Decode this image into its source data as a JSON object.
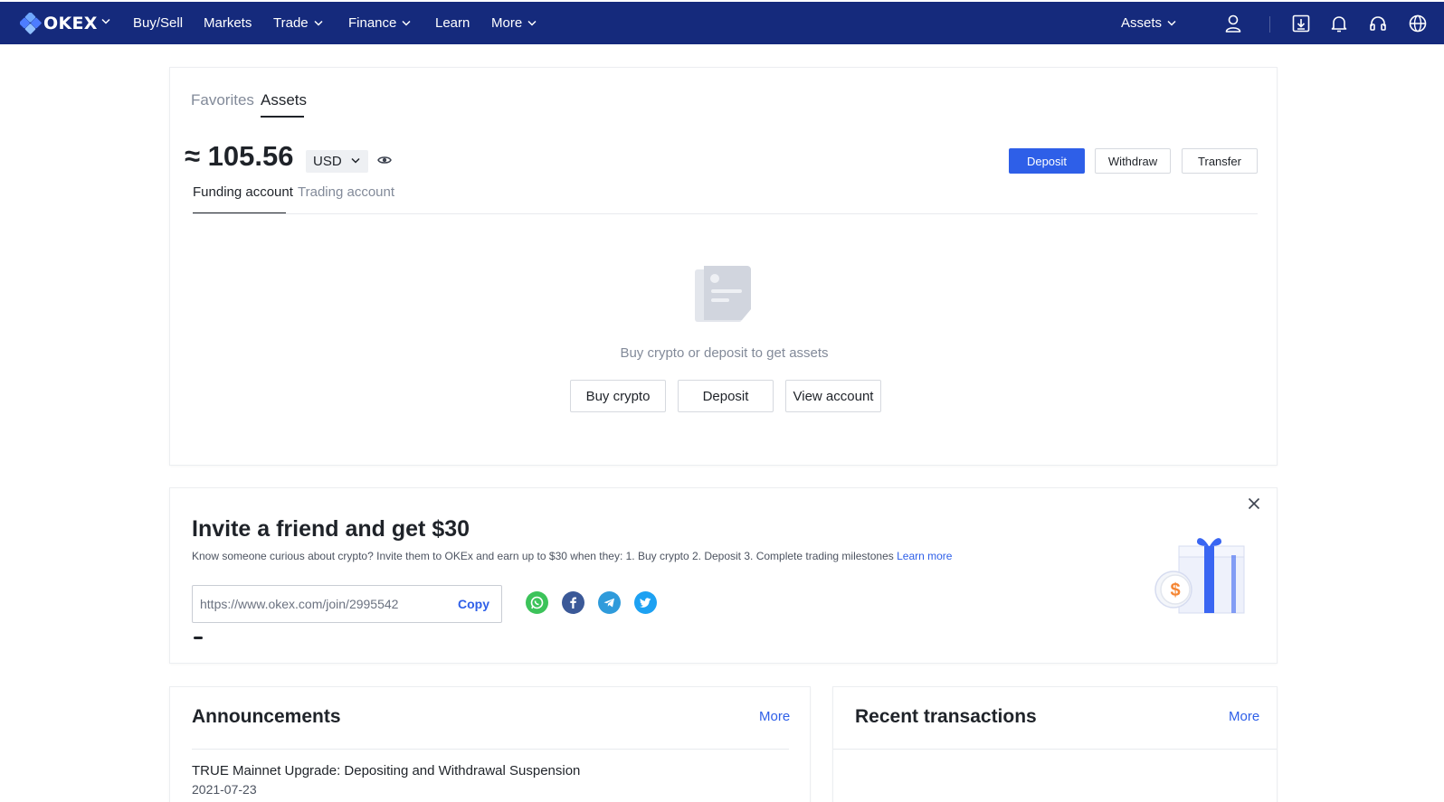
{
  "nav": {
    "brand": "OKEX",
    "items": [
      {
        "label": "Buy/Sell"
      },
      {
        "label": "Markets"
      },
      {
        "label": "Trade"
      },
      {
        "label": "Finance"
      },
      {
        "label": "Learn"
      },
      {
        "label": "More"
      }
    ],
    "assets_label": "Assets",
    "icons": [
      "user-icon",
      "download-icon",
      "bell-icon",
      "headset-icon",
      "globe-icon"
    ]
  },
  "assets_card": {
    "tabs": [
      "Favorites",
      "Assets"
    ],
    "active_tab": "Assets",
    "balance": "≈ 105.56",
    "currency": "USD",
    "actions": {
      "deposit": "Deposit",
      "withdraw": "Withdraw",
      "transfer": "Transfer"
    },
    "account_tabs": [
      "Funding account",
      "Trading account"
    ],
    "active_account_tab": "Funding account",
    "empty_state": {
      "message": "Buy crypto or deposit to get assets",
      "buttons": {
        "buy": "Buy crypto",
        "deposit": "Deposit",
        "view": "View account"
      }
    }
  },
  "invite": {
    "title": "Invite a friend and get $30",
    "description": "Know someone curious about crypto? Invite them to OKEx and earn up to $30 when they: 1. Buy crypto 2. Deposit 3. Complete trading milestones",
    "learn_more": "Learn more",
    "referral_url": "https://www.okex.com/join/2995542",
    "copy_label": "Copy",
    "social": [
      "whatsapp-icon",
      "facebook-icon",
      "telegram-icon",
      "twitter-icon"
    ],
    "coin_symbol": "$"
  },
  "announcements": {
    "title": "Announcements",
    "more": "More",
    "items": [
      {
        "title": "TRUE Mainnet Upgrade: Depositing and Withdrawal Suspension",
        "date": "2021-07-23"
      }
    ]
  },
  "transactions": {
    "title": "Recent transactions",
    "more": "More"
  },
  "colors": {
    "nav_bg": "#152a7c",
    "primary": "#2e5fe8",
    "text": "#1f2329",
    "muted": "#828a99"
  }
}
